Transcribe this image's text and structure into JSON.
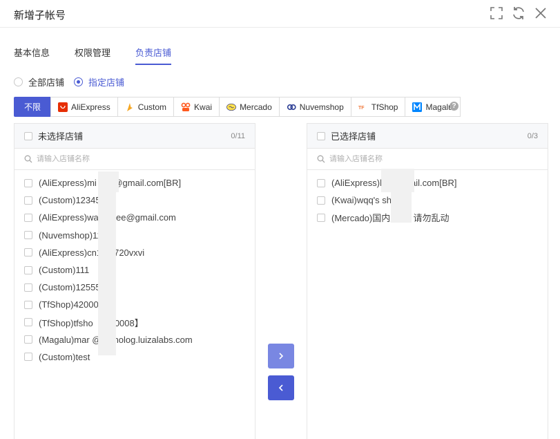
{
  "dialog": {
    "title": "新增子帐号"
  },
  "tabs": [
    {
      "label": "基本信息",
      "active": false
    },
    {
      "label": "权限管理",
      "active": false
    },
    {
      "label": "负责店铺",
      "active": true
    }
  ],
  "scope_radios": [
    {
      "label": "全部店铺",
      "checked": false
    },
    {
      "label": "指定店铺",
      "checked": true
    }
  ],
  "platforms": [
    {
      "label": "不限",
      "icon": "none",
      "active": true
    },
    {
      "label": "AliExpress",
      "icon": "aliexpress-icon",
      "active": false
    },
    {
      "label": "Custom",
      "icon": "custom-icon",
      "active": false
    },
    {
      "label": "Kwai",
      "icon": "kwai-icon",
      "active": false
    },
    {
      "label": "Mercado",
      "icon": "mercado-icon",
      "active": false
    },
    {
      "label": "Nuvemshop",
      "icon": "nuvemshop-icon",
      "active": false
    },
    {
      "label": "TfShop",
      "icon": "tfshop-icon",
      "active": false
    },
    {
      "label": "Magalu",
      "icon": "magalu-icon",
      "active": false
    }
  ],
  "help": {
    "glyph": "?"
  },
  "left_panel": {
    "title": "未选择店铺",
    "count": "0/11",
    "search_placeholder": "请输入店铺名称",
    "items": [
      "(AliExpress)mi        nsp@gmail.com[BR]",
      "(Custom)12345",
      "(AliExpress)wa        hopee@gmail.com",
      "(Nuvemshop)11",
      "(AliExpress)cn1       71720vxvi",
      "(Custom)111",
      "(Custom)12555",
      "(TfShop)42000",
      "(TfShop)tfsho        【460008】",
      "(Magalu)mar        @homolog.luizalabs.com",
      "(Custom)test"
    ]
  },
  "right_panel": {
    "title": "已选择店铺",
    "count": "0/3",
    "search_placeholder": "请输入店铺名称",
    "items": [
      "(AliExpress)le              @gmail.com[BR]",
      "(Kwai)wqq's sh          o",
      "(Mercado)国内用          号 请勿乱动"
    ]
  },
  "colors": {
    "accent": "#4a5bd3",
    "accent_light": "#7987e2",
    "border": "#e6e6e6",
    "panel_header_bg": "#f7f8fa"
  }
}
